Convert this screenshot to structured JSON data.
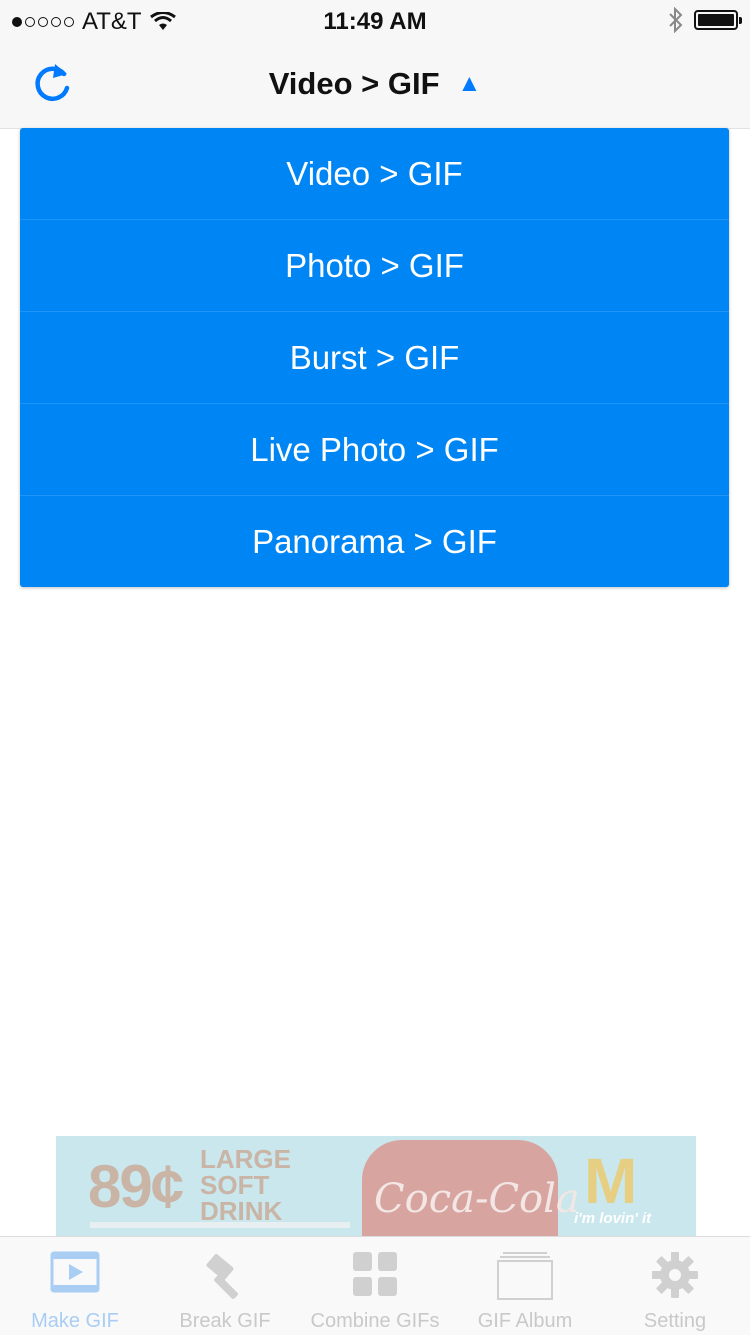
{
  "status_bar": {
    "carrier": "AT&T",
    "time": "11:49 AM",
    "signal_bars_filled": 1,
    "signal_bars_total": 5
  },
  "nav": {
    "title": "Video > GIF",
    "caret": "▲",
    "refresh_icon": "refresh-icon"
  },
  "dropdown": {
    "items": [
      {
        "label": "Video > GIF"
      },
      {
        "label": "Photo > GIF"
      },
      {
        "label": "Burst > GIF"
      },
      {
        "label": "Live Photo > GIF"
      },
      {
        "label": "Panorama > GIF"
      }
    ]
  },
  "ad": {
    "price": "89¢",
    "line1": "LARGE",
    "line2": "SOFT",
    "line3": "DRINK",
    "brand": "Coca‑Cola",
    "logo": "M",
    "slogan": "i'm lovin' it"
  },
  "tabs": [
    {
      "label": "Make GIF",
      "icon": "play-video-icon",
      "active": true
    },
    {
      "label": "Break GIF",
      "icon": "hammer-icon",
      "active": false
    },
    {
      "label": "Combine GIFs",
      "icon": "grid-icon",
      "active": false
    },
    {
      "label": "GIF Album",
      "icon": "album-icon",
      "active": false
    },
    {
      "label": "Setting",
      "icon": "gear-icon",
      "active": false
    }
  ],
  "colors": {
    "accent": "#007aff",
    "dropdown_bg": "#0086f4",
    "tab_inactive": "#c9c9c9",
    "tab_active": "#a9cdf3"
  }
}
